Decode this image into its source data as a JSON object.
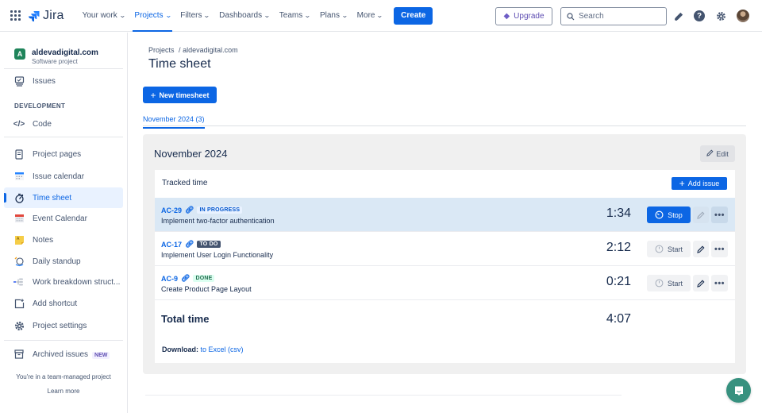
{
  "topbar": {
    "app_name": "Jira",
    "nav": [
      {
        "label": "Your work",
        "active": false
      },
      {
        "label": "Projects",
        "active": true
      },
      {
        "label": "Filters",
        "active": false
      },
      {
        "label": "Dashboards",
        "active": false
      },
      {
        "label": "Teams",
        "active": false
      },
      {
        "label": "Plans",
        "active": false
      },
      {
        "label": "More",
        "active": false
      }
    ],
    "create_label": "Create",
    "upgrade_label": "Upgrade",
    "search_placeholder": "Search",
    "icons": [
      "notifications-icon",
      "help-icon",
      "settings-icon",
      "avatar"
    ]
  },
  "sidebar": {
    "project_name": "aldevadigital.com",
    "project_type": "Software project",
    "project_initial": "A",
    "items_top": [
      {
        "label": "Issues",
        "icon": "issues-icon"
      }
    ],
    "section_heading": "DEVELOPMENT",
    "dev_items": [
      {
        "label": "Code",
        "icon": "code-icon"
      }
    ],
    "items": [
      {
        "label": "Project pages",
        "icon": "page-icon",
        "active": false
      },
      {
        "label": "Issue calendar",
        "icon": "calendar-icon",
        "active": false
      },
      {
        "label": "Time sheet",
        "icon": "stopwatch-icon",
        "active": true
      },
      {
        "label": "Event Calendar",
        "icon": "event-calendar-icon",
        "active": false
      },
      {
        "label": "Notes",
        "icon": "notes-icon",
        "active": false
      },
      {
        "label": "Daily standup",
        "icon": "standup-icon",
        "active": false
      },
      {
        "label": "Work breakdown struct...",
        "icon": "wbs-icon",
        "active": false
      },
      {
        "label": "Add shortcut",
        "icon": "add-shortcut-icon",
        "active": false
      },
      {
        "label": "Project settings",
        "icon": "gear-icon",
        "active": false
      }
    ],
    "archived_label": "Archived issues",
    "archived_badge": "NEW",
    "footer_text": "You're in a team-managed project",
    "learn_more": "Learn more"
  },
  "main": {
    "breadcrumb": {
      "root": "Projects",
      "separator": "/",
      "current": "aldevadigital.com"
    },
    "title": "Time sheet",
    "new_timesheet_label": "New timesheet",
    "tabs": [
      {
        "label": "November 2024 (3)",
        "active": true
      }
    ],
    "panel": {
      "title": "November 2024",
      "edit_label": "Edit",
      "tracked_title": "Tracked time",
      "add_issue_label": "Add issue",
      "rows": [
        {
          "key": "AC-29",
          "status": "IN PROGRESS",
          "status_type": "progress",
          "summary": "Implement two-factor authentication",
          "time": "1:34",
          "action": "Stop",
          "running": true
        },
        {
          "key": "AC-17",
          "status": "TO DO",
          "status_type": "todo",
          "summary": "Implement User Login Functionality",
          "time": "2:12",
          "action": "Start",
          "running": false
        },
        {
          "key": "AC-9",
          "status": "DONE",
          "status_type": "done",
          "summary": "Create Product Page Layout",
          "time": "0:21",
          "action": "Start",
          "running": false
        }
      ],
      "total_label": "Total time",
      "total_value": "4:07",
      "download_label": "Download:",
      "download_link": "to Excel (csv)"
    }
  },
  "colors": {
    "brand": "#0c66e4",
    "running_row": "#dae8f5",
    "chat": "#37917f"
  }
}
